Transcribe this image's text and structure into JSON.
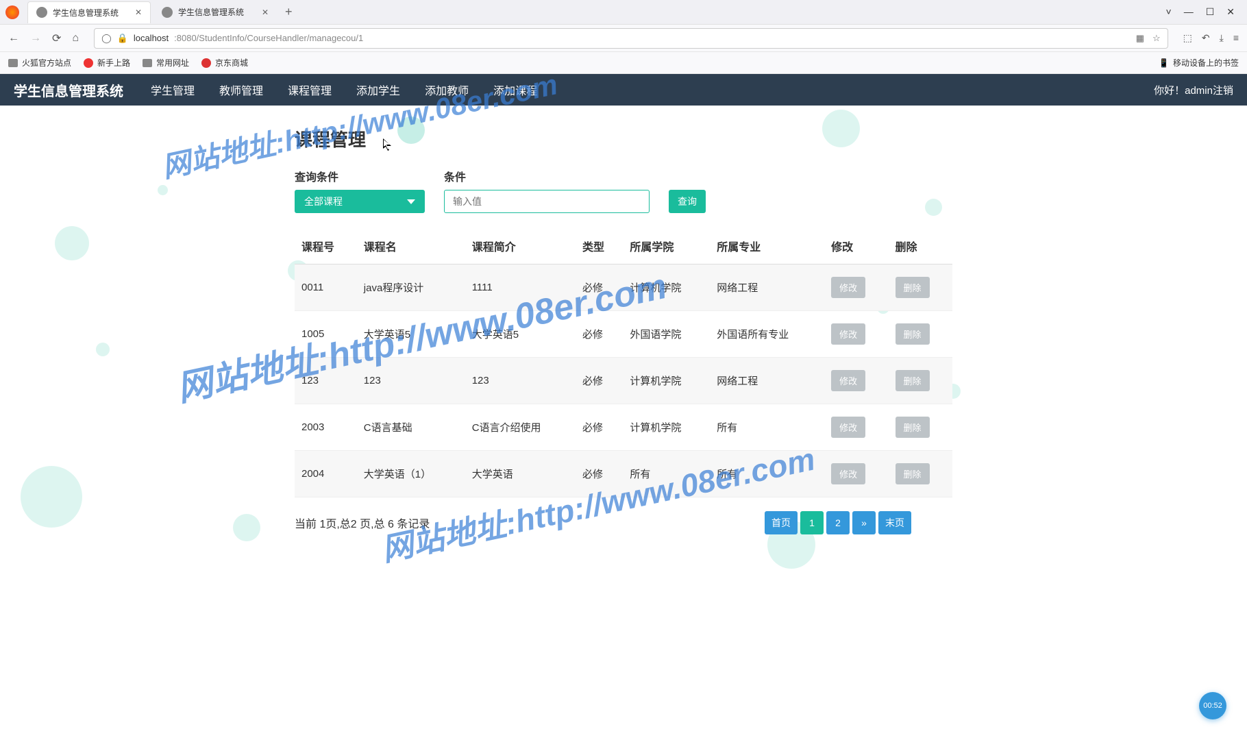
{
  "browser": {
    "tabs": [
      {
        "title": "学生信息管理系统",
        "active": true
      },
      {
        "title": "学生信息管理系统",
        "active": false
      }
    ],
    "new_tab": "+",
    "window": {
      "expand": "˅",
      "min": "—",
      "max": "☐",
      "close": "✕"
    },
    "nav": {
      "back": "←",
      "forward": "→",
      "refresh": "⟳",
      "home": "⌂"
    },
    "addr": {
      "shield": "◯",
      "lock": "🔒",
      "host": "localhost",
      "port_path": ":8080/StudentInfo/CourseHandler/managecou/1",
      "qr": "▦",
      "star": "☆"
    },
    "right_icons": {
      "ext": "⬚",
      "undo": "↶",
      "download": "⤓",
      "menu": "≡"
    },
    "bookmarks": {
      "items": [
        "火狐官方站点",
        "新手上路",
        "常用网址",
        "京东商城"
      ],
      "mobile": "移动设备上的书签"
    }
  },
  "nav": {
    "brand": "学生信息管理系统",
    "items": [
      "学生管理",
      "教师管理",
      "课程管理",
      "添加学生",
      "添加教师",
      "添加课程"
    ],
    "greeting": "你好！admin",
    "logout": "注销"
  },
  "page": {
    "title": "课程管理",
    "search": {
      "label_condition": "查询条件",
      "dropdown_selected": "全部课程",
      "label_value": "条件",
      "placeholder": "输入值",
      "btn": "查询"
    },
    "table": {
      "headers": [
        "课程号",
        "课程名",
        "课程简介",
        "类型",
        "所属学院",
        "所属专业",
        "修改",
        "删除"
      ],
      "rows": [
        {
          "id": "0011",
          "name": "java程序设计",
          "desc": "1111",
          "type": "必修",
          "college": "计算机学院",
          "major": "网络工程"
        },
        {
          "id": "1005",
          "name": "大学英语5",
          "desc": "大学英语5",
          "type": "必修",
          "college": "外国语学院",
          "major": "外国语所有专业"
        },
        {
          "id": "123",
          "name": "123",
          "desc": "123",
          "type": "必修",
          "college": "计算机学院",
          "major": "网络工程"
        },
        {
          "id": "2003",
          "name": "C语言基础",
          "desc": "C语言介绍使用",
          "type": "必修",
          "college": "计算机学院",
          "major": "所有"
        },
        {
          "id": "2004",
          "name": "大学英语（1）",
          "desc": "大学英语",
          "type": "必修",
          "college": "所有",
          "major": "所有"
        }
      ],
      "btn_edit": "修改",
      "btn_delete": "删除"
    },
    "pager": {
      "info": "当前 1页,总2 页,总 6 条记录",
      "first": "首页",
      "p1": "1",
      "p2": "2",
      "next": "»",
      "last": "末页"
    }
  },
  "watermark": "网站地址:http://www.08er.com",
  "timer": "00:52"
}
